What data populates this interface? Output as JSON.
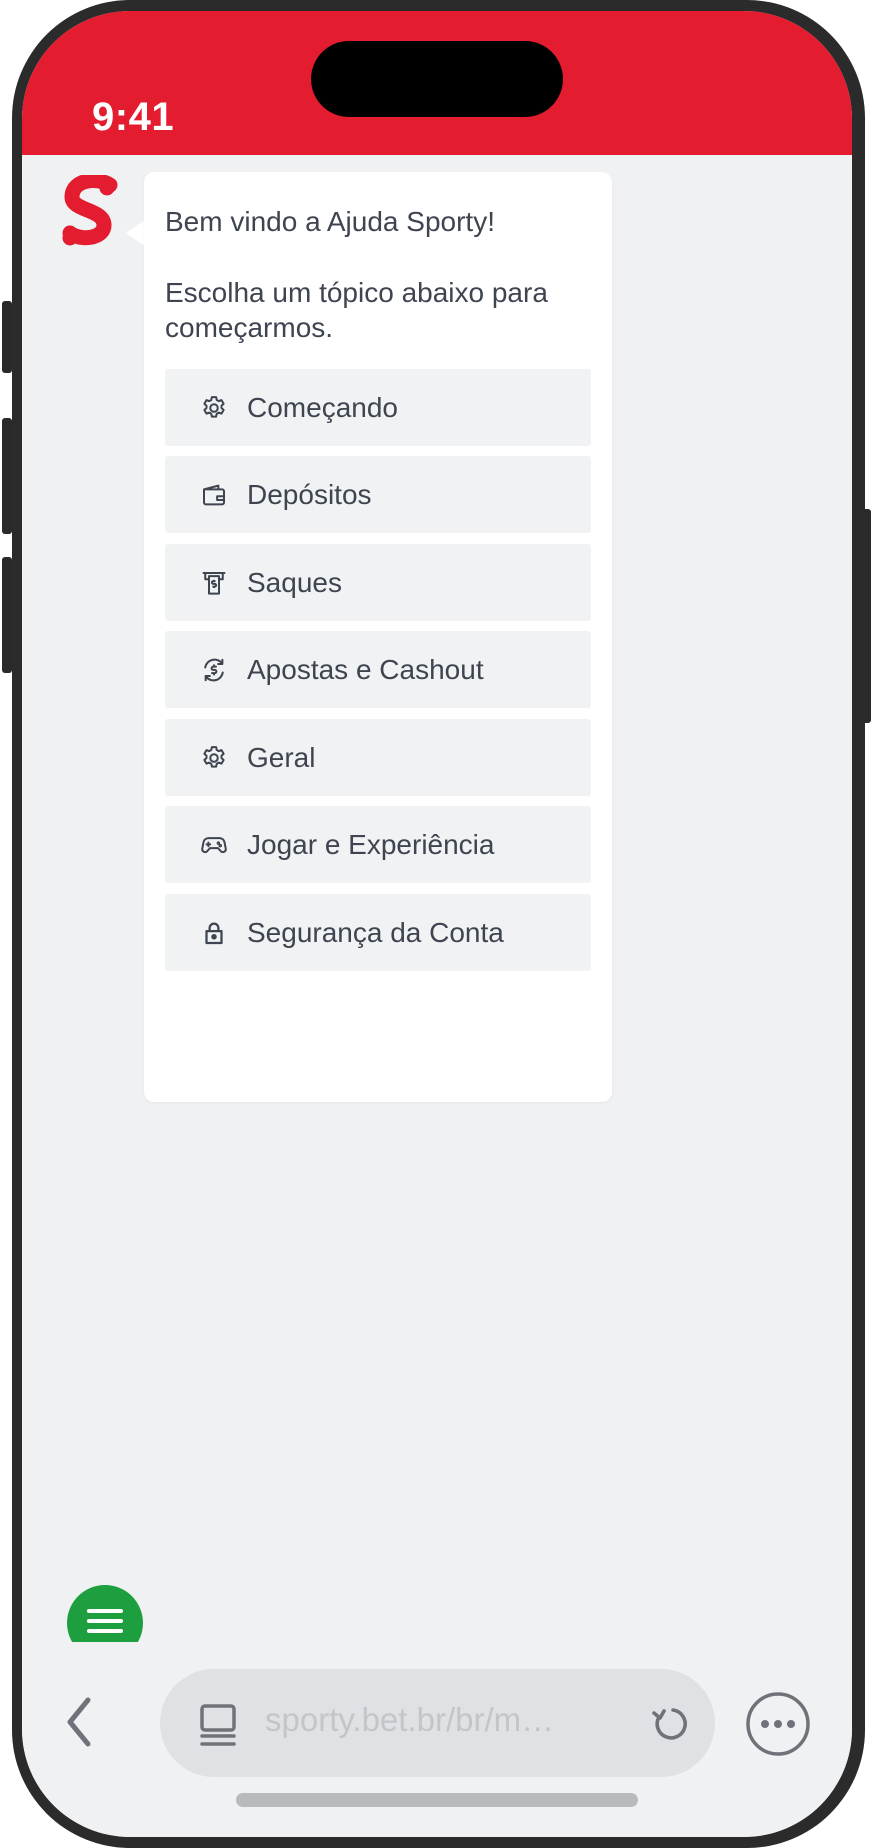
{
  "status_bar": {
    "time": "9:41",
    "background_color": "#e31d2f"
  },
  "chat": {
    "avatar": {
      "icon": "sporty-logo-icon",
      "color": "#e31d2f"
    },
    "greeting": "Bem vindo a Ajuda Sporty!",
    "prompt": "Escolha um tópico abaixo para começarmos.",
    "topics": [
      {
        "label": "Começando",
        "icon": "gear-icon"
      },
      {
        "label": "Depósitos",
        "icon": "wallet-icon"
      },
      {
        "label": "Saques",
        "icon": "withdraw-cash-icon"
      },
      {
        "label": "Apostas e Cashout",
        "icon": "currency-exchange-icon"
      },
      {
        "label": "Geral",
        "icon": "gear-icon"
      },
      {
        "label": "Jogar e Experiência",
        "icon": "gamepad-icon"
      },
      {
        "label": "Segurança da Conta",
        "icon": "lock-icon"
      }
    ]
  },
  "fab": {
    "icon": "menu-icon",
    "color": "#1e9f3f"
  },
  "browser": {
    "url": "sporty.bet.br/br/m…",
    "back_icon": "chevron-left-icon",
    "tabs_icon": "tabs-icon",
    "reload_icon": "reload-icon",
    "more_icon": "more-icon"
  }
}
